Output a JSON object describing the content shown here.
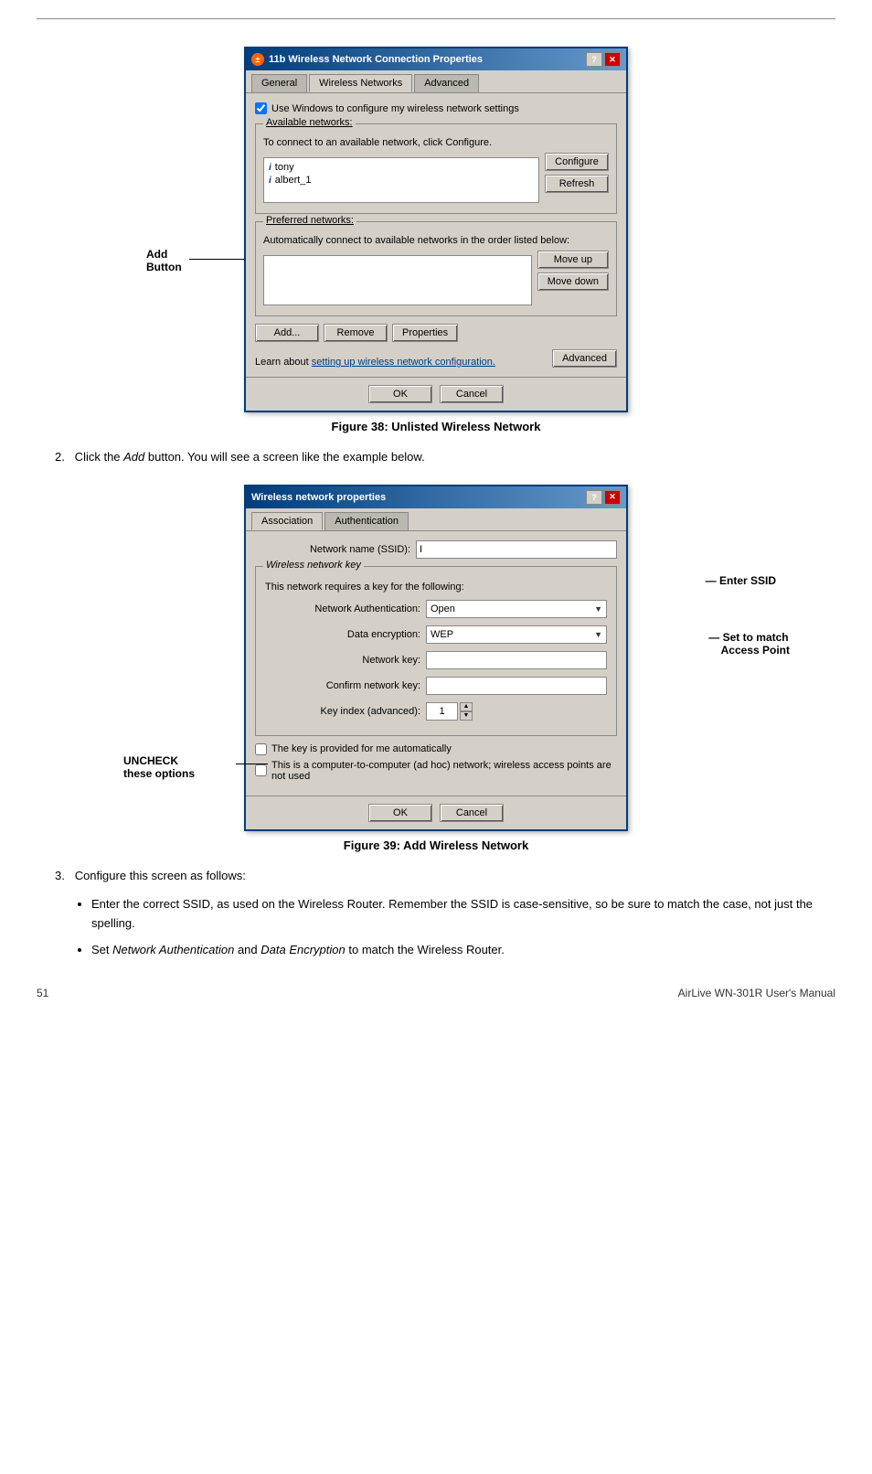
{
  "page": {
    "top_divider": true,
    "footer": {
      "page_number": "51",
      "manual_title": "AirLive WN-301R User's Manual"
    }
  },
  "figure1": {
    "title": "11b Wireless Network Connection Properties",
    "tabs": [
      "General",
      "Wireless Networks",
      "Advanced"
    ],
    "active_tab": "Wireless Networks",
    "use_windows_checkbox": true,
    "use_windows_label": "Use Windows to configure my wireless network settings",
    "available_networks": {
      "label": "Available networks:",
      "description": "To connect to an available network, click Configure.",
      "networks": [
        "tony",
        "albert_1"
      ],
      "configure_btn": "Configure",
      "refresh_btn": "Refresh"
    },
    "preferred_networks": {
      "label": "Preferred networks:",
      "description": "Automatically connect to available networks in the order listed below:",
      "move_up_btn": "Move up",
      "move_down_btn": "Move down"
    },
    "bottom_buttons": [
      "Add...",
      "Remove",
      "Properties"
    ],
    "learn_text1": "Learn about ",
    "learn_link": "setting up wireless network configuration.",
    "advanced_btn": "Advanced",
    "ok_btn": "OK",
    "cancel_btn": "Cancel",
    "caption": "Figure 38: Unlisted Wireless Network",
    "annotation": {
      "label1": "Add",
      "label2": "Button"
    }
  },
  "step2": {
    "text": "Click the Add button. You will see a screen like the example below."
  },
  "figure2": {
    "title": "Wireless network properties",
    "tabs": [
      "Association",
      "Authentication"
    ],
    "active_tab": "Association",
    "network_name_label": "Network name (SSID):",
    "network_name_value": "I",
    "wireless_key_group": "Wireless network key",
    "key_description": "This network requires a key for the following:",
    "auth_label": "Network Authentication:",
    "auth_value": "Open",
    "encryption_label": "Data encryption:",
    "encryption_value": "WEP",
    "network_key_label": "Network key:",
    "confirm_key_label": "Confirm network key:",
    "key_index_label": "Key index (advanced):",
    "key_index_value": "1",
    "auto_key_checkbox": false,
    "auto_key_label": "The key is provided for me automatically",
    "adhoc_checkbox": false,
    "adhoc_label": "This is a computer-to-computer (ad hoc) network; wireless access points are not used",
    "ok_btn": "OK",
    "cancel_btn": "Cancel",
    "caption": "Figure 39: Add Wireless Network",
    "annotations": {
      "enter_ssid": "Enter SSID",
      "set_to_match": "Set to match",
      "access_point": "Access Point",
      "uncheck": "UNCHECK",
      "these_options": "these options"
    }
  },
  "step3": {
    "intro": "Configure this screen as follows:",
    "bullets": [
      "Enter the correct SSID, as used on the Wireless Router. Remember the SSID is case-sensitive, so be sure to match the case, not just the spelling.",
      "Set Network Authentication and Data Encryption to match the Wireless Router."
    ]
  }
}
